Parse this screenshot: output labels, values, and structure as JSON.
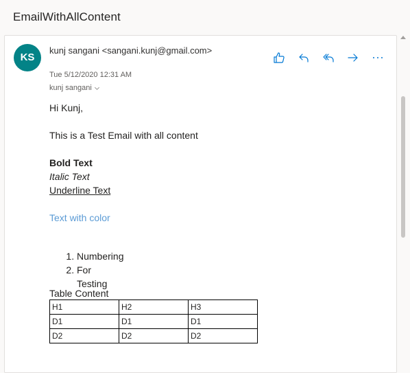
{
  "subject": "EmailWithAllContent",
  "message": {
    "avatar_initials": "KS",
    "avatar_color": "#038387",
    "from": "kunj sangani <sangani.kunj@gmail.com>",
    "date": "Tue 5/12/2020 12:31 AM",
    "to": "kunj sangani",
    "actions": [
      {
        "name": "like",
        "icon": "thumbs-up-icon"
      },
      {
        "name": "reply",
        "icon": "reply-icon"
      },
      {
        "name": "reply-all",
        "icon": "reply-all-icon"
      },
      {
        "name": "forward",
        "icon": "forward-icon"
      },
      {
        "name": "more",
        "icon": "more-icon"
      }
    ]
  },
  "body": {
    "greeting": "Hi Kunj,",
    "intro": "This is a Test Email with all content",
    "bold_text": "Bold Text",
    "italic_text": "Italic Text",
    "underline_text": "Underline Text",
    "colored_text": "Text with color",
    "colored_text_color": "#5b9bd5",
    "numbered_list": [
      "Numbering",
      "For Testing"
    ],
    "table_caption": "Table Content",
    "table_rows": [
      [
        "H1",
        "H2",
        "H3"
      ],
      [
        "D1",
        "D1",
        "D1"
      ],
      [
        "D2",
        "D2",
        "D2"
      ]
    ]
  },
  "colors": {
    "accent": "#0078d4",
    "avatar": "#038387"
  }
}
